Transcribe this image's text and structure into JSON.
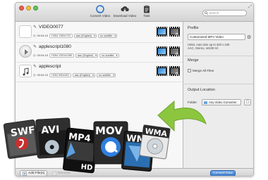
{
  "toolbar": {
    "convert_label": "Convert Video",
    "download_label": "Download Video",
    "task_label": "Task",
    "search_placeholder": "Search"
  },
  "files": [
    {
      "title": "VIDEO0077",
      "duration": "00:04:10",
      "video": "H264 1280x720",
      "audio": "aac (English)",
      "subtitle": "no subtitle",
      "thumb": "blank"
    },
    {
      "title": "applescript1080",
      "duration": "00:04:10",
      "video": "H264 1920x1080",
      "audio": "aac (English)",
      "subtitle": "no subtitle",
      "thumb": "play"
    },
    {
      "title": "applescript",
      "duration": "00:04:10",
      "video": "H264 960x540",
      "audio": "aac (English)",
      "subtitle": "no subtitle",
      "thumb": "note"
    }
  ],
  "profile": {
    "heading": "Profile",
    "selected": "Customized MP4 Video",
    "desc_line1": "H264, Auto size up to 320 x 240",
    "desc_line2": "AAC, Stereo, 44100 Hz"
  },
  "merge": {
    "heading": "Merge",
    "checkbox_label": "Merge All Files",
    "checked": false
  },
  "output": {
    "heading": "Output Location",
    "folder_label": "Folder",
    "folder_value": "Any Video Converter"
  },
  "bottom": {
    "add_label": "Add File(s)",
    "remove_label": "Remove",
    "convert_label": "Convert Now"
  },
  "formats": [
    "SWF",
    "AVI",
    "MP4",
    "MOV",
    "WMV",
    "WMA"
  ],
  "formats_extra": "HD",
  "colors": {
    "accent": "#3b76c8",
    "arrow": "#8cc63f"
  }
}
